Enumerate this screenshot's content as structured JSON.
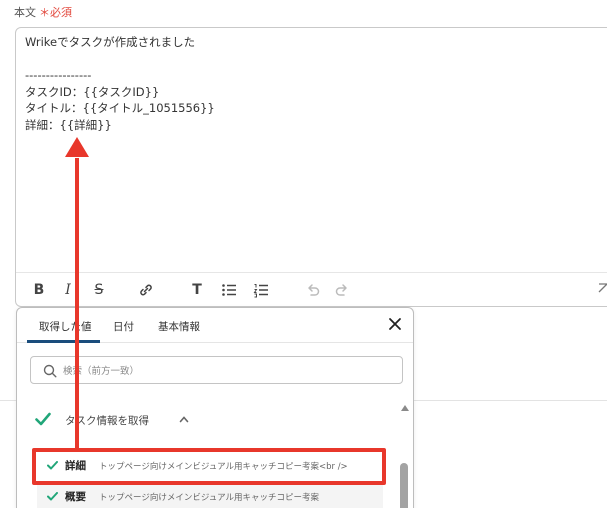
{
  "field": {
    "label": "本文",
    "required_mark": "＊",
    "required_text": "必須"
  },
  "editor": {
    "lines": [
      "Wrikeでタスクが作成されました",
      "",
      "----------------",
      "タスクID：{{タスクID}}",
      "タイトル：{{タイトル_1051556}}",
      "詳細：{{詳細}}"
    ]
  },
  "toolbar": {
    "bold": "B",
    "italic": "I",
    "strike": "S",
    "heading": "T"
  },
  "popup": {
    "tabs": [
      {
        "label": "取得した値"
      },
      {
        "label": "日付"
      },
      {
        "label": "基本情報"
      }
    ],
    "search_placeholder": "検索（前方一致）",
    "group": {
      "label": "タスク情報を取得"
    },
    "items": [
      {
        "name": "詳細",
        "value": "トップページ向けメインビジュアル用キャッチコピー考案<br />"
      },
      {
        "name": "概要",
        "value": "トップページ向けメインビジュアル用キャッチコピー考案"
      }
    ]
  },
  "colors": {
    "accent": "#1a4d7c",
    "check_green": "#21a679",
    "annotation_red": "#e8372b",
    "required_red": "#e2483d"
  }
}
